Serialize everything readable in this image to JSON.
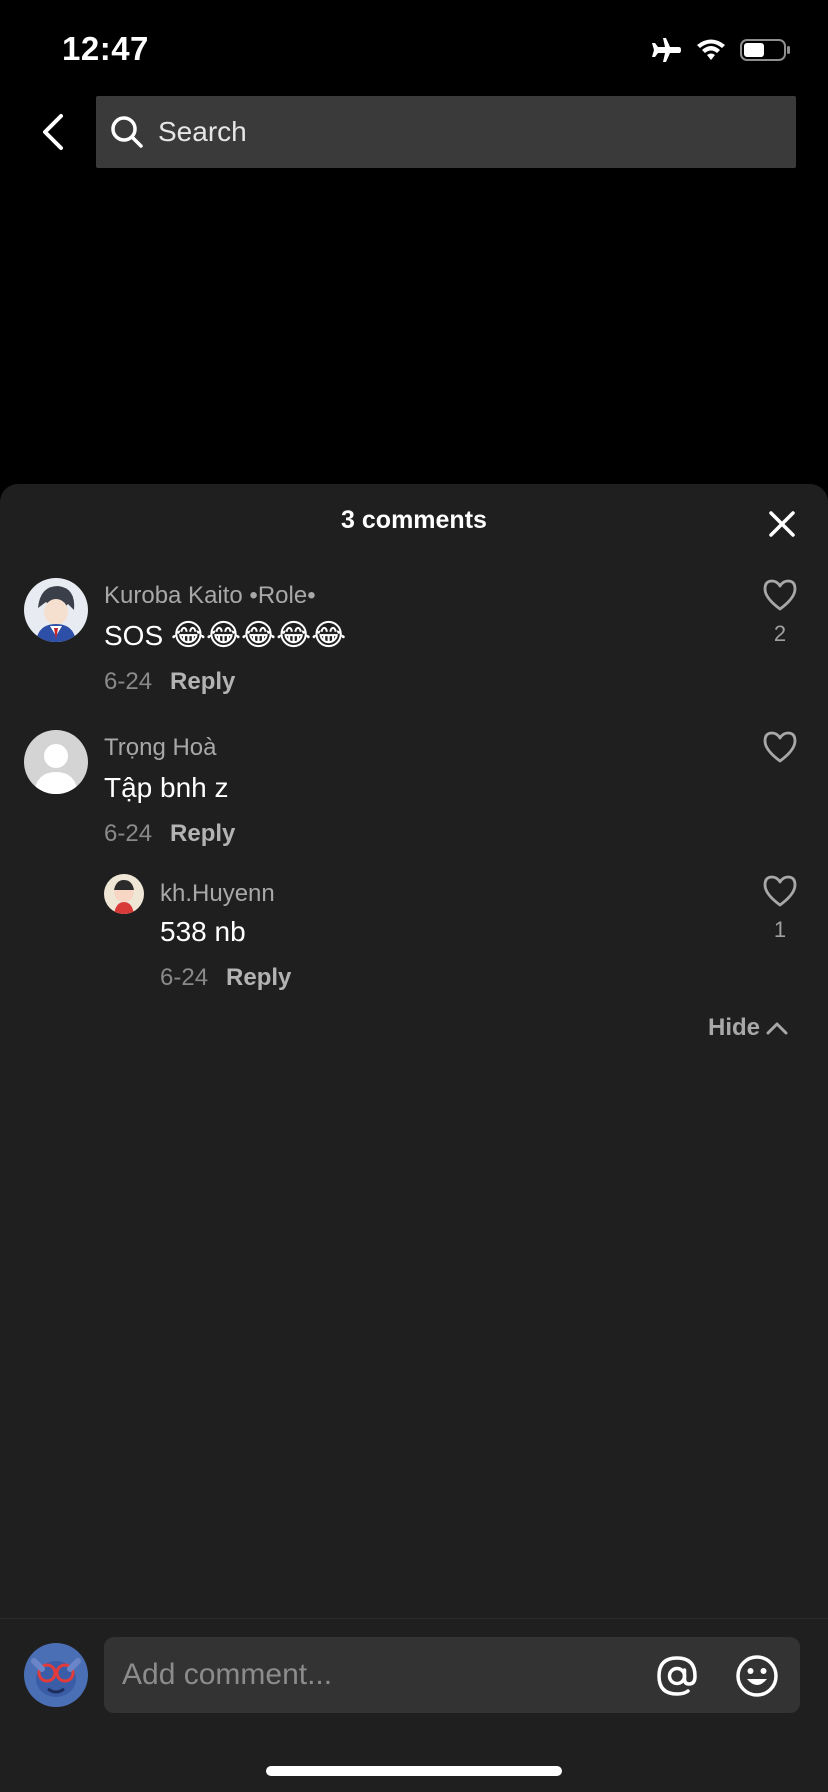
{
  "status_bar": {
    "time": "12:47"
  },
  "search": {
    "placeholder": "Search"
  },
  "sheet": {
    "title": "3 comments"
  },
  "comments": [
    {
      "username": "Kuroba Kaito •Role•",
      "text": "SOS",
      "emoji": "😂😂😂😂😂",
      "date": "6-24",
      "reply_label": "Reply",
      "likes": "2"
    },
    {
      "username": "Trọng Hoà",
      "text": "Tập bnh z",
      "date": "6-24",
      "reply_label": "Reply",
      "likes": ""
    }
  ],
  "reply": {
    "username": "kh.Huyenn",
    "text": "538 nb",
    "date": "6-24",
    "reply_label": "Reply",
    "likes": "1"
  },
  "hide_label": "Hide",
  "composer": {
    "placeholder": "Add comment..."
  },
  "colors": {
    "sheet_bg": "#1f1f1f",
    "field_bg": "#333333",
    "search_bg": "#3a3a3a"
  }
}
